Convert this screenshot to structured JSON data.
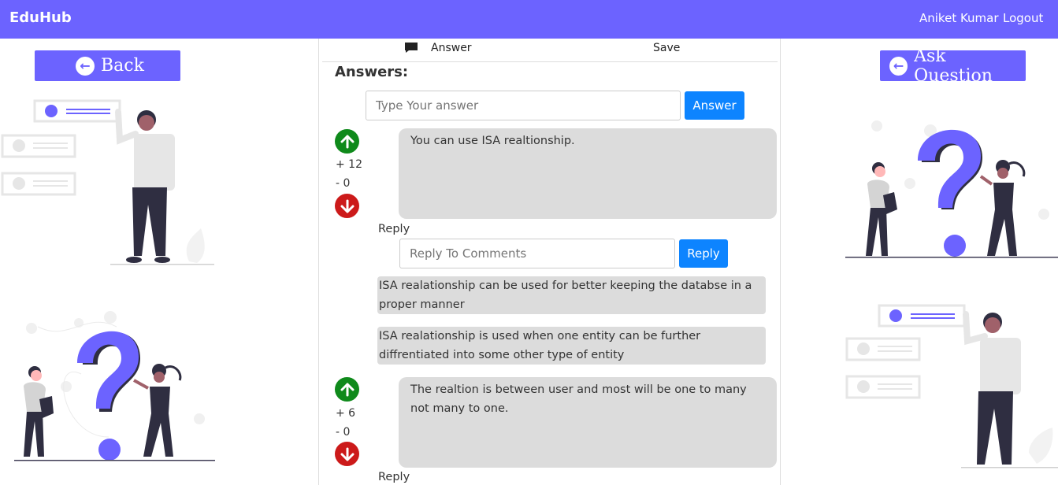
{
  "navbar": {
    "brand": "EduHub",
    "user_name": "Aniket Kumar",
    "logout_label": "Logout"
  },
  "left": {
    "back_label": "Back",
    "back_icon": "arrow-left-circle-icon"
  },
  "right": {
    "ask_label": "Ask Question",
    "ask_icon": "arrow-left-circle-icon"
  },
  "topbar": {
    "answer_label": "Answer",
    "answer_icon": "comment-icon",
    "save_label": "Save"
  },
  "answers": {
    "heading": "Answers:",
    "input_placeholder": "Type Your answer",
    "submit_label": "Answer",
    "items": [
      {
        "upvotes": "+ 12",
        "downvotes": "- 0",
        "text": "You can use ISA realtionship.",
        "reply_label": "Reply",
        "reply_placeholder": "Reply To Comments",
        "reply_button": "Reply",
        "comments": [
          "ISA realationship can be used for better keeping the databse in a proper manner",
          "ISA realationship is used when one entity can be further diffrentiated into some other type of entity"
        ]
      },
      {
        "upvotes": "+ 6",
        "downvotes": "- 0",
        "text": "The realtion is between user and most will be one to many not many to one.",
        "reply_label": "Reply"
      }
    ]
  },
  "colors": {
    "brand": "#6c63ff",
    "primary_button": "#0d84ff",
    "upvote": "#0f8a1b",
    "downvote": "#cc1a1a",
    "answer_bg": "#dcdcdc"
  }
}
